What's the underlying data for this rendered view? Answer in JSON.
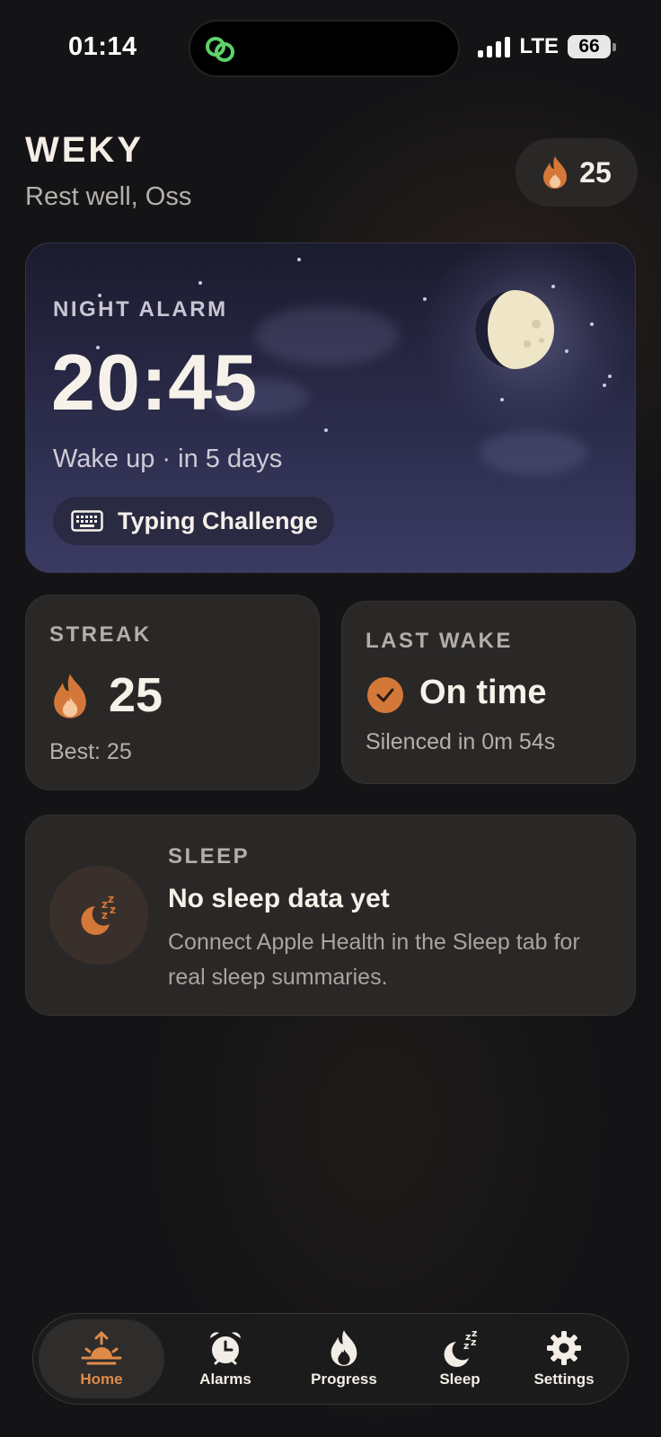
{
  "status_bar": {
    "time": "01:14",
    "network": "LTE",
    "battery": "66"
  },
  "header": {
    "app_name": "WEKY",
    "greeting": "Rest well, Oss",
    "streak_count": "25"
  },
  "alarm_card": {
    "label": "NIGHT ALARM",
    "time": "20:45",
    "subtitle": "Wake up · in 5 days",
    "challenge": "Typing Challenge"
  },
  "streak_card": {
    "label": "STREAK",
    "value": "25",
    "best": "Best: 25"
  },
  "last_wake_card": {
    "label": "LAST WAKE",
    "status": "On time",
    "detail": "Silenced in 0m 54s"
  },
  "sleep_card": {
    "label": "SLEEP",
    "title": "No sleep data yet",
    "description": "Connect Apple Health in the Sleep tab for real sleep summaries."
  },
  "tabs": [
    {
      "label": "Home",
      "icon": "sunrise-icon",
      "active": true
    },
    {
      "label": "Alarms",
      "icon": "alarm-clock-icon",
      "active": false
    },
    {
      "label": "Progress",
      "icon": "flame-icon",
      "active": false
    },
    {
      "label": "Sleep",
      "icon": "moon-zzz-icon",
      "active": false
    },
    {
      "label": "Settings",
      "icon": "gear-icon",
      "active": false
    }
  ],
  "colors": {
    "accent": "#e08a48",
    "background": "#141416",
    "card": "#2a2827",
    "alarm_card_top": "#1b1b2e",
    "alarm_card_bottom": "#3b3b64"
  }
}
